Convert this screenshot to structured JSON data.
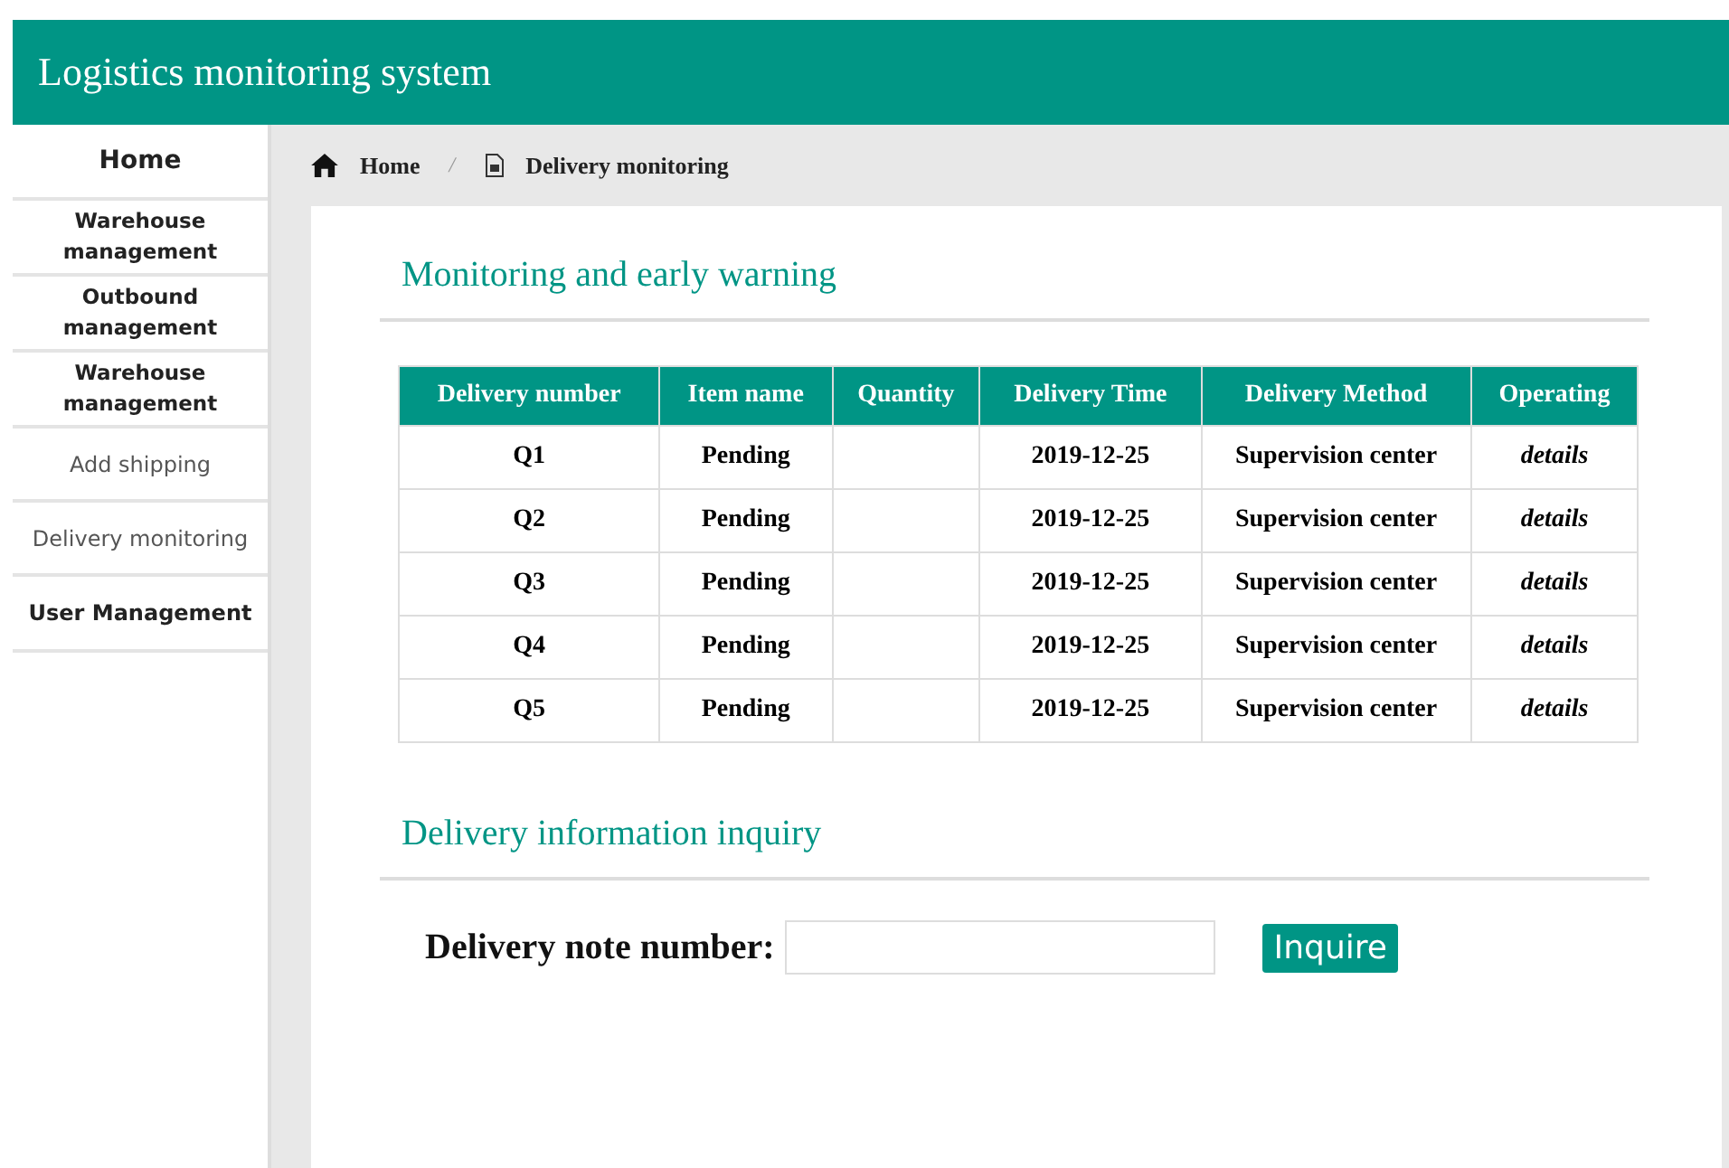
{
  "header": {
    "title": "Logistics monitoring system"
  },
  "sidebar": {
    "items": [
      {
        "label": "Home",
        "kind": "home"
      },
      {
        "label": "Warehouse management",
        "kind": "group"
      },
      {
        "label": "Outbound management",
        "kind": "group"
      },
      {
        "label": "Warehouse management",
        "kind": "group"
      },
      {
        "label": "Add shipping",
        "kind": "link"
      },
      {
        "label": "Delivery monitoring",
        "kind": "link"
      },
      {
        "label": "User Management",
        "kind": "section"
      }
    ]
  },
  "breadcrumb": [
    {
      "label": "Home",
      "kind": "home"
    },
    {
      "label": "Delivery monitoring",
      "kind": "page"
    }
  ],
  "breadcrumb_separator": "/",
  "monitoring": {
    "title": "Monitoring and early warning",
    "columns": [
      "Delivery number",
      "Item name",
      "Quantity",
      "Delivery Time",
      "Delivery Method",
      "Operating"
    ],
    "rows": [
      [
        "Q1",
        "Pending",
        "",
        "2019-12-25",
        "Supervision center",
        "details"
      ],
      [
        "Q2",
        "Pending",
        "",
        "2019-12-25",
        "Supervision center",
        "details"
      ],
      [
        "Q3",
        "Pending",
        "",
        "2019-12-25",
        "Supervision center",
        "details"
      ],
      [
        "Q4",
        "Pending",
        "",
        "2019-12-25",
        "Supervision center",
        "details"
      ],
      [
        "Q5",
        "Pending",
        "",
        "2019-12-25",
        "Supervision center",
        "details"
      ]
    ]
  },
  "inquiry": {
    "title": "Delivery information inquiry",
    "label": "Delivery note number:",
    "button": "Inquire"
  }
}
